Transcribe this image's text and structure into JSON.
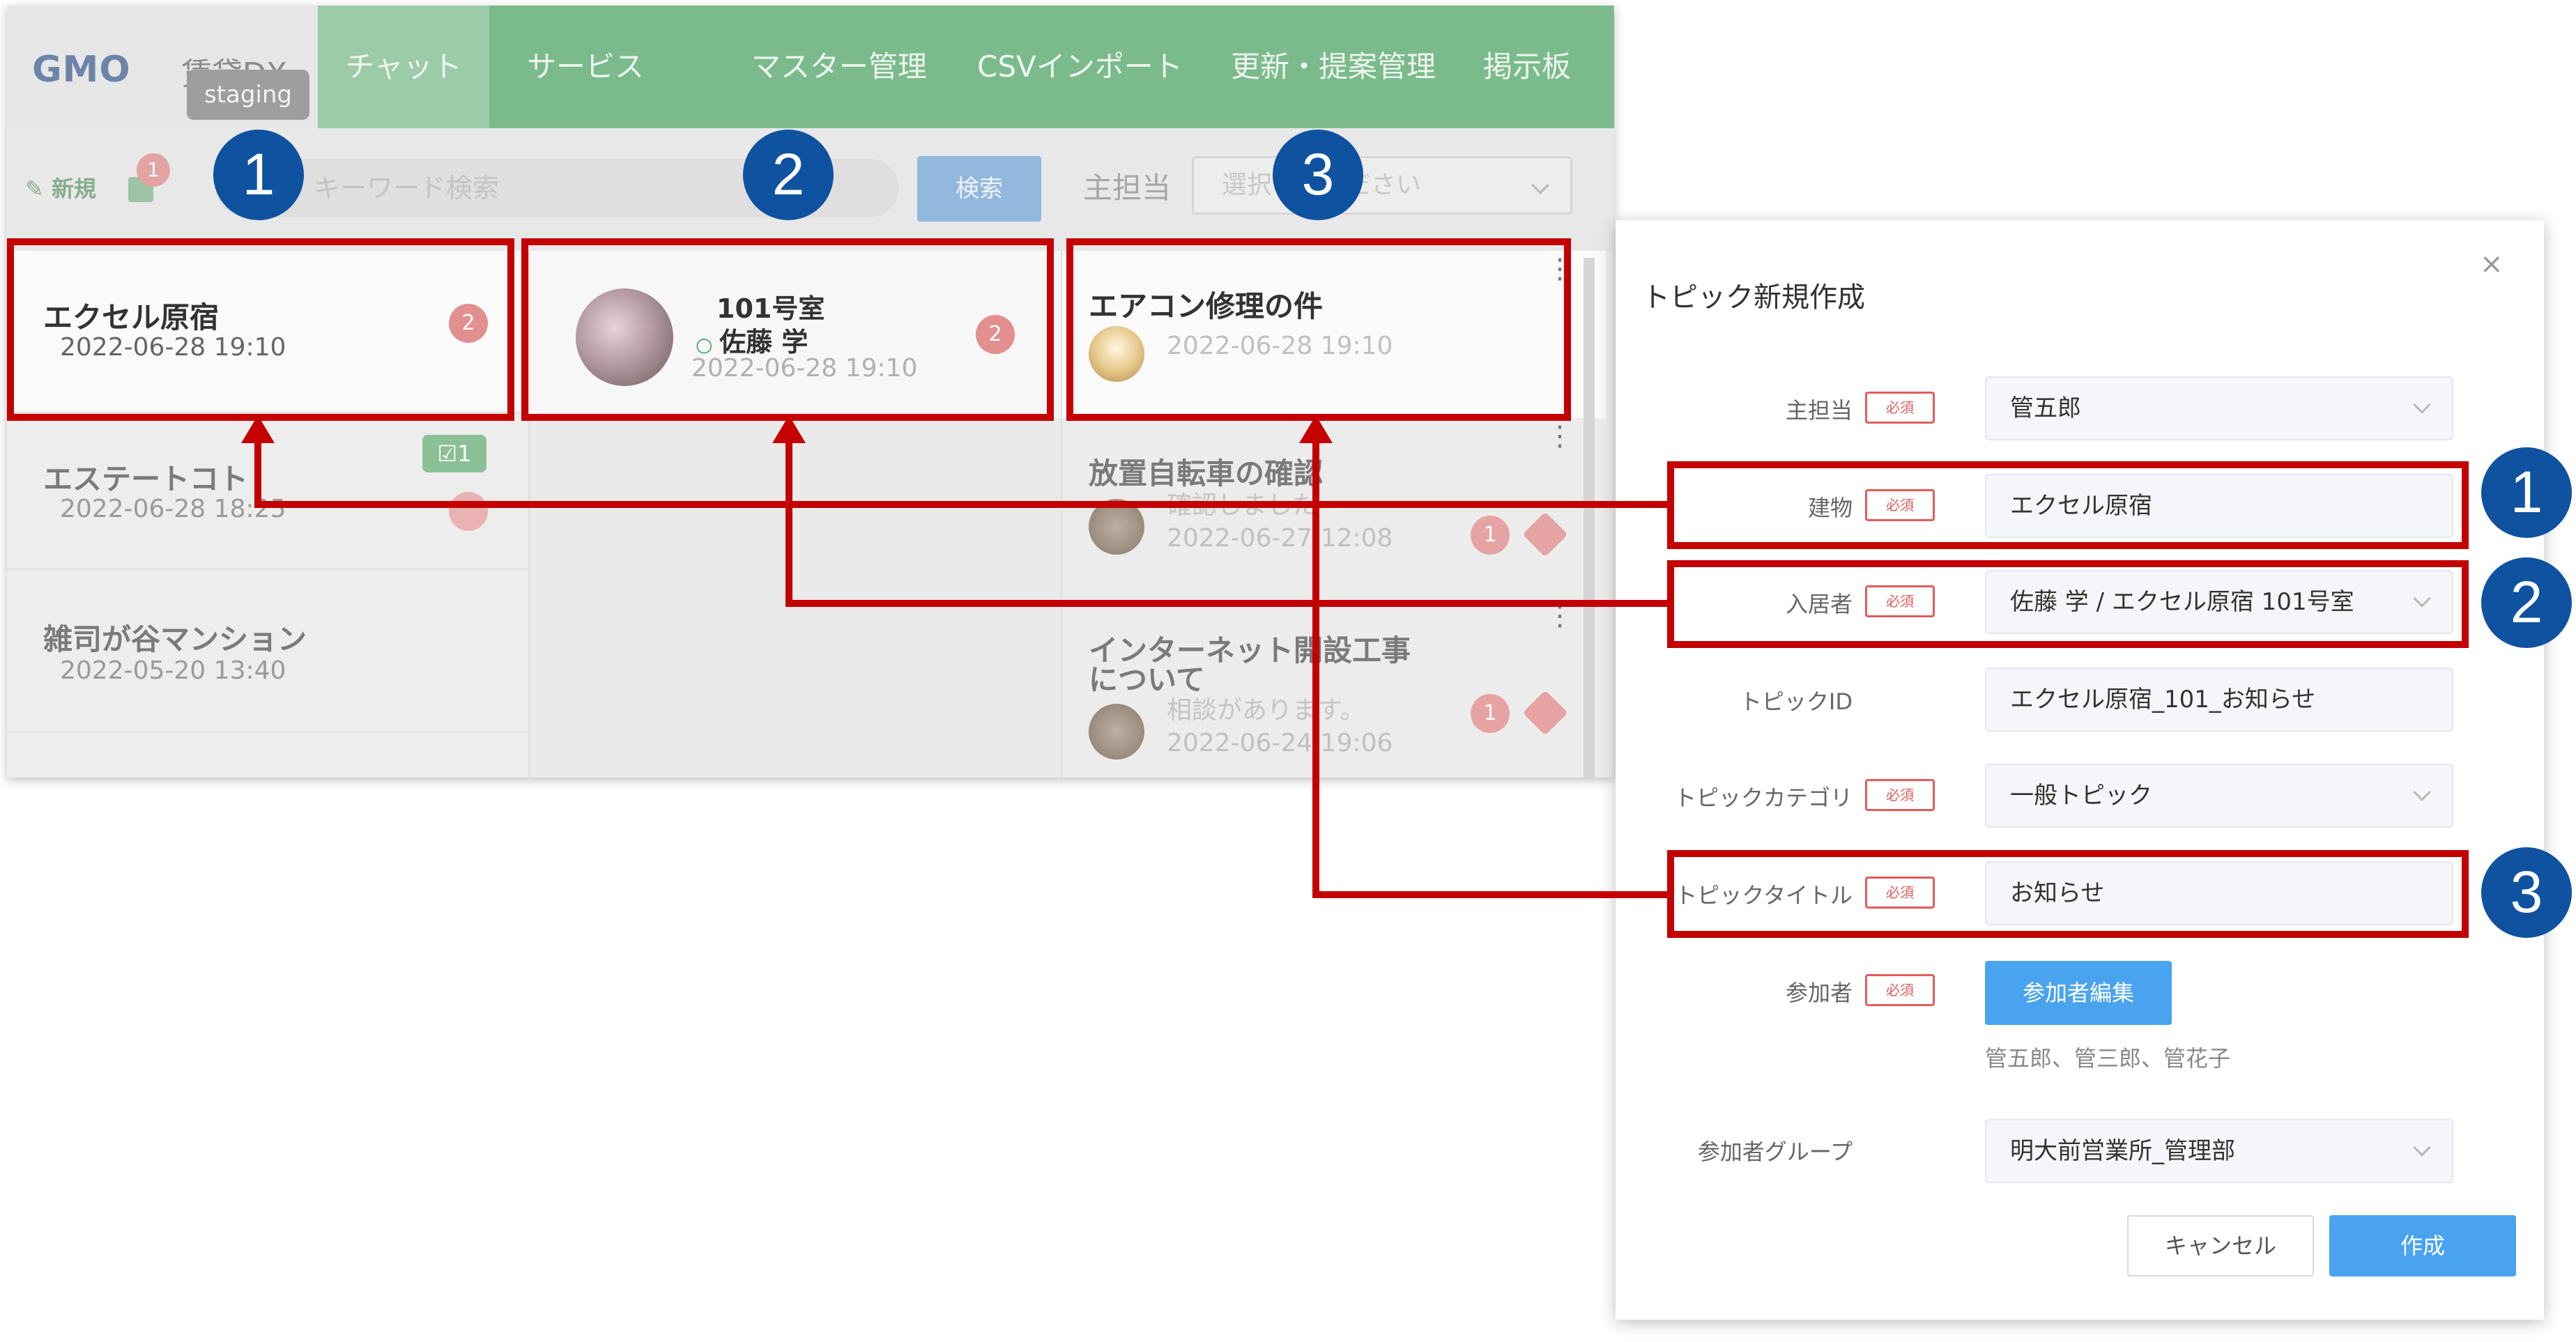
{
  "app": {
    "logo": "GMO",
    "logo_suffix": "賃貸DX",
    "env_badge": "staging",
    "nav": [
      "チャット",
      "サービス",
      "マスター管理",
      "CSVインポート",
      "更新・提案管理",
      "掲示板"
    ],
    "toolbar": {
      "new_label": "新規",
      "new_badge": "1",
      "search_placeholder": "キーワード検索",
      "search_button": "検索",
      "assignee_label": "主担当",
      "assignee_placeholder": "選択してください"
    },
    "buildings": [
      {
        "name": "エクセル原宿",
        "date": "2022-06-28 19:10",
        "badge": "2"
      },
      {
        "name": "エステートコト",
        "date": "2022-06-28 18:25",
        "badge": "",
        "check_badge": "1"
      },
      {
        "name": "雑司が谷マンション",
        "date": "2022-05-20 13:40"
      }
    ],
    "resident": {
      "room": "101号室",
      "name": "佐藤 学",
      "date": "2022-06-28 19:10",
      "badge": "2"
    },
    "topics": [
      {
        "title": "エアコン修理の件",
        "date": "2022-06-28 19:10"
      },
      {
        "title": "放置自転車の確認",
        "preview": "確認しました",
        "date": "2022-06-27 12:08",
        "badge": "1"
      },
      {
        "title_line1": "インターネット開設工事",
        "title_line2": "について",
        "preview": "相談があります。",
        "date": "2022-06-24 19:06",
        "badge": "1"
      }
    ]
  },
  "dialog": {
    "title": "トピック新規作成",
    "close": "×",
    "required": "必須",
    "fields": [
      {
        "label": "主担当",
        "value": "管五郎",
        "required": true
      },
      {
        "label": "建物",
        "value": "エクセル原宿",
        "required": true
      },
      {
        "label": "入居者",
        "value": "佐藤 学 / エクセル原宿 101号室",
        "required": true
      },
      {
        "label": "トピックID",
        "value": "エクセル原宿_101_お知らせ",
        "required": false
      },
      {
        "label": "トピックカテゴリ",
        "value": "一般トピック",
        "required": true
      },
      {
        "label": "トピックタイトル",
        "value": "お知らせ",
        "required": true
      },
      {
        "label": "参加者",
        "value": "",
        "required": true
      },
      {
        "label": "参加者グループ",
        "value": "明大前営業所_管理部",
        "required": false
      }
    ],
    "participants_button": "参加者編集",
    "participants": "管五郎、管三郎、管花子",
    "cancel": "キャンセル",
    "create": "作成"
  },
  "callouts": [
    "1",
    "2",
    "3"
  ],
  "colors": {
    "highlight": "#c40000",
    "callout": "#0f52a0",
    "nav": "#7bbb8b",
    "primary": "#4aa3ee"
  }
}
